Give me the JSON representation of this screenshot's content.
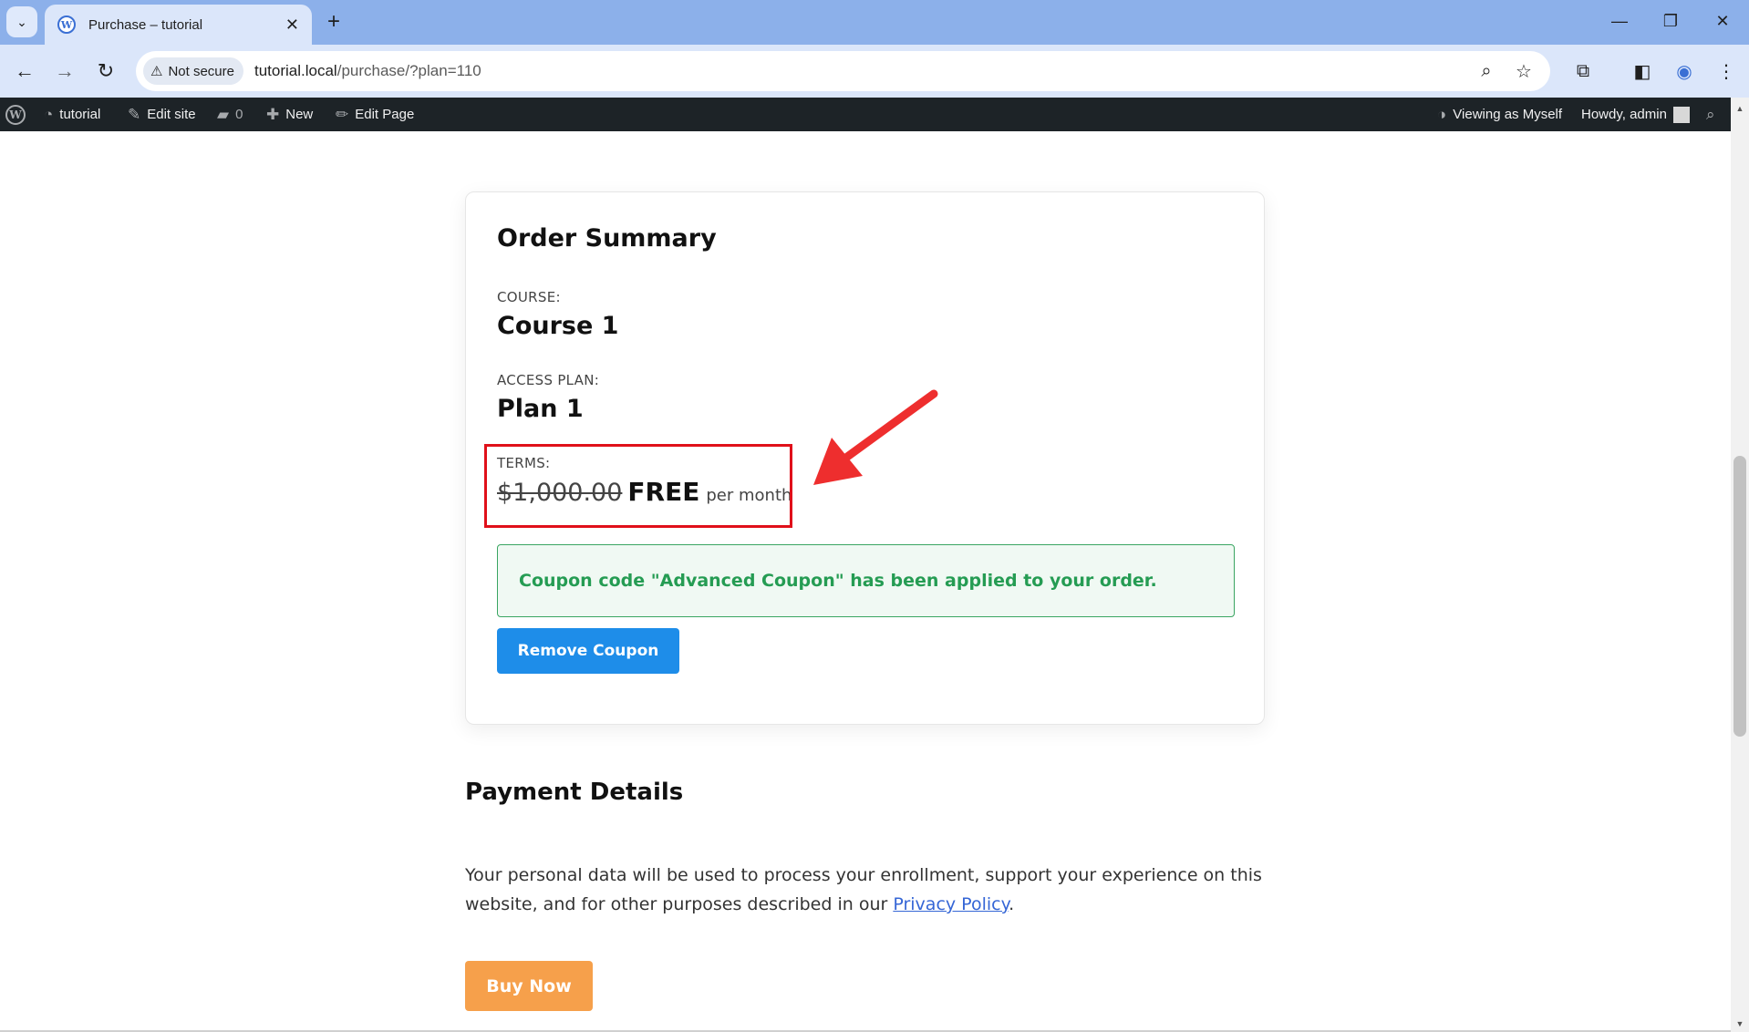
{
  "browser": {
    "tab_title": "Purchase – tutorial",
    "tab_close": "✕",
    "new_tab": "+",
    "security_label": "Not secure",
    "url_host": "tutorial.local",
    "url_path": "/purchase/?plan=110"
  },
  "adminbar": {
    "site_name": "tutorial",
    "edit_site": "Edit site",
    "comments_count": "0",
    "new_label": "New",
    "edit_page": "Edit Page",
    "viewing_as": "Viewing as Myself",
    "howdy": "Howdy, admin"
  },
  "order_summary": {
    "heading": "Order Summary",
    "course_label": "COURSE:",
    "course_value": "Course 1",
    "plan_label": "ACCESS PLAN:",
    "plan_value": "Plan 1",
    "terms_label": "TERMS:",
    "original_price": "$1,000.00",
    "sale_price": "FREE",
    "period": "per month",
    "coupon_message": "Coupon code \"Advanced Coupon\" has been applied to your order.",
    "remove_coupon_label": "Remove Coupon"
  },
  "payment": {
    "heading": "Payment Details",
    "privacy_text_before": "Your personal data will be used to process your enrollment, support your experience on this website, and for other purposes described in our ",
    "privacy_link": "Privacy Policy",
    "privacy_text_after": ".",
    "buy_label": "Buy Now"
  },
  "colors": {
    "annotation_red": "#e0101a",
    "button_blue": "#1e8de9",
    "buy_orange": "#f6a04b",
    "notice_green": "#259c53"
  },
  "icons": {
    "tab_menu": "chevron-down-icon",
    "favicon": "wordpress-icon",
    "back": "arrow-left-icon",
    "forward": "arrow-right-icon",
    "reload": "reload-icon",
    "warning": "warning-icon",
    "zoom": "zoom-icon",
    "bookmark": "star-icon",
    "extensions": "puzzle-icon",
    "sidepanel": "sidepanel-icon",
    "profile": "profile-icon",
    "menu": "kebab-menu-icon"
  }
}
